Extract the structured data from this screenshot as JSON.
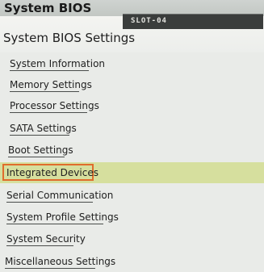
{
  "app": {
    "title": "System BIOS"
  },
  "slot_tag": "SLOT-04",
  "page": {
    "title": "System BIOS Settings"
  },
  "menu": {
    "items": [
      {
        "label": "System Information"
      },
      {
        "label": "Memory Settings"
      },
      {
        "label": "Processor Settings"
      },
      {
        "label": "SATA Settings"
      },
      {
        "label": "Boot Settings"
      },
      {
        "label": "Integrated Devices",
        "selected": true
      },
      {
        "label": "Serial Communication"
      },
      {
        "label": "System Profile Settings"
      },
      {
        "label": "System Security"
      },
      {
        "label": "Miscellaneous Settings"
      }
    ]
  },
  "colors": {
    "selected_row": "#d6df9e",
    "focus_frame": "#e06c2c",
    "slot_tag_bg": "#3a3d3c"
  }
}
